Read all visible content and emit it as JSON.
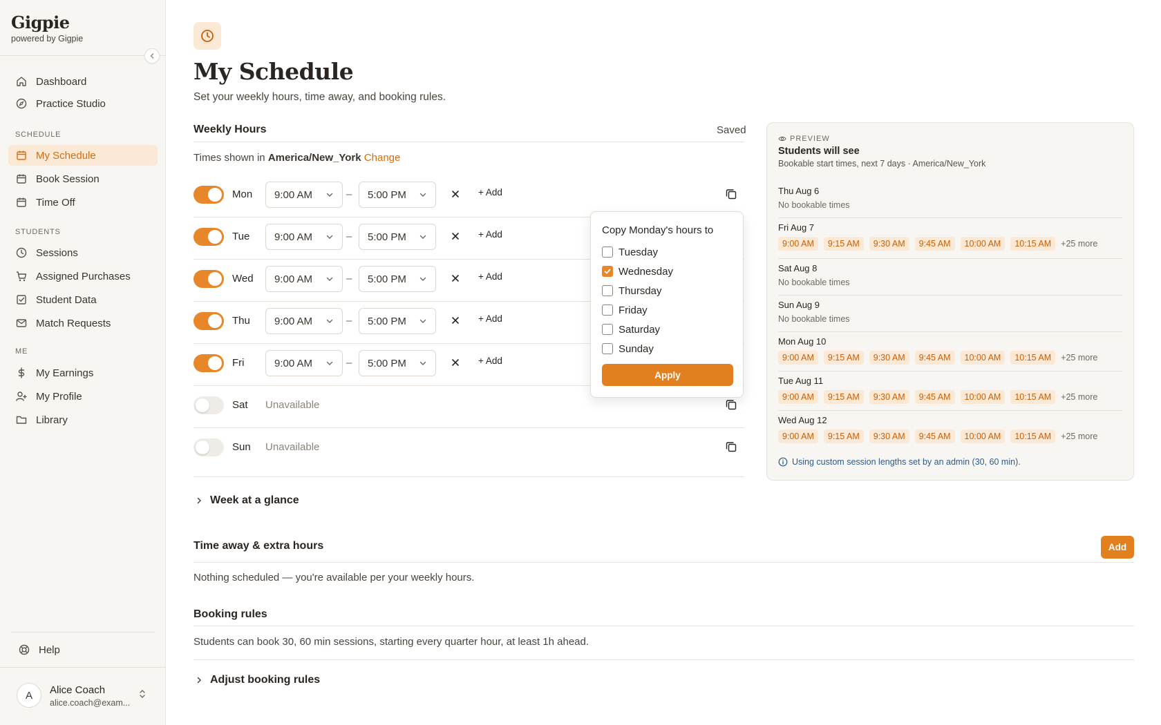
{
  "sidebar": {
    "brand": "Gigpie",
    "brand_sub": "powered by Gigpie",
    "items_top": [
      {
        "label": "Dashboard",
        "icon": "home-icon"
      },
      {
        "label": "Practice Studio",
        "icon": "compass-icon"
      }
    ],
    "sections": {
      "schedule": "SCHEDULE",
      "students": "STUDENTS",
      "me": "ME"
    },
    "schedule_items": [
      {
        "label": "My Schedule",
        "icon": "calendar-icon",
        "active": true
      },
      {
        "label": "Book Session",
        "icon": "calendar-icon"
      },
      {
        "label": "Time Off",
        "icon": "calendar-icon"
      }
    ],
    "students_items": [
      {
        "label": "Sessions",
        "icon": "clock-icon"
      },
      {
        "label": "Assigned Purchases",
        "icon": "cart-icon"
      },
      {
        "label": "Student Data",
        "icon": "check-square-icon"
      },
      {
        "label": "Match Requests",
        "icon": "mail-icon"
      }
    ],
    "me_items": [
      {
        "label": "My Earnings",
        "icon": "dollar-icon"
      },
      {
        "label": "My Profile",
        "icon": "user-icon"
      },
      {
        "label": "Library",
        "icon": "folder-icon"
      }
    ],
    "help": "Help",
    "user": {
      "initial": "A",
      "name": "Alice Coach",
      "email": "alice.coach@exam..."
    }
  },
  "header": {
    "title": "My Schedule",
    "subtitle": "Set your weekly hours, time away, and booking rules."
  },
  "weekly": {
    "heading": "Weekly Hours",
    "status": "Saved",
    "tz_prefix": "Times shown in",
    "tz": "America/New_York",
    "tz_change": "Change",
    "dash": "–",
    "add": "+ Add",
    "unavailable": "Unavailable",
    "days": [
      {
        "label": "Mon",
        "on": true,
        "start": "9:00 AM",
        "end": "5:00 PM"
      },
      {
        "label": "Tue",
        "on": true,
        "start": "9:00 AM",
        "end": "5:00 PM"
      },
      {
        "label": "Wed",
        "on": true,
        "start": "9:00 AM",
        "end": "5:00 PM"
      },
      {
        "label": "Thu",
        "on": true,
        "start": "9:00 AM",
        "end": "5:00 PM"
      },
      {
        "label": "Fri",
        "on": true,
        "start": "9:00 AM",
        "end": "5:00 PM"
      },
      {
        "label": "Sat",
        "on": false
      },
      {
        "label": "Sun",
        "on": false
      }
    ]
  },
  "copy_popover": {
    "title": "Copy Monday's hours to",
    "options": [
      {
        "label": "Tuesday",
        "checked": false
      },
      {
        "label": "Wednesday",
        "checked": true
      },
      {
        "label": "Thursday",
        "checked": false
      },
      {
        "label": "Friday",
        "checked": false
      },
      {
        "label": "Saturday",
        "checked": false
      },
      {
        "label": "Sunday",
        "checked": false
      }
    ],
    "apply": "Apply"
  },
  "glance": "Week at a glance",
  "time_away": {
    "heading": "Time away & extra hours",
    "add": "Add",
    "empty": "Nothing scheduled — you're available per your weekly hours."
  },
  "booking": {
    "heading": "Booking rules",
    "text": "Students can book 30, 60 min sessions, starting every quarter hour, at least 1h ahead.",
    "adjust": "Adjust booking rules"
  },
  "preview": {
    "label": "PREVIEW",
    "title": "Students will see",
    "subtitle": "Bookable start times, next 7 days · America/New_York",
    "none_text": "No bookable times",
    "slots": [
      "9:00 AM",
      "9:15 AM",
      "9:30 AM",
      "9:45 AM",
      "10:00 AM",
      "10:15 AM"
    ],
    "more": "+25 more",
    "days": [
      {
        "name": "Thu Aug 6",
        "bookable": false
      },
      {
        "name": "Fri Aug 7",
        "bookable": true
      },
      {
        "name": "Sat Aug 8",
        "bookable": false
      },
      {
        "name": "Sun Aug 9",
        "bookable": false
      },
      {
        "name": "Mon Aug 10",
        "bookable": true
      },
      {
        "name": "Tue Aug 11",
        "bookable": true
      },
      {
        "name": "Wed Aug 12",
        "bookable": true
      }
    ],
    "note": "Using custom session lengths set by an admin (30, 60 min)."
  },
  "colors": {
    "accent": "#e2801f",
    "accent_soft": "#fbe9d6",
    "link_blue": "#2f5a89"
  }
}
